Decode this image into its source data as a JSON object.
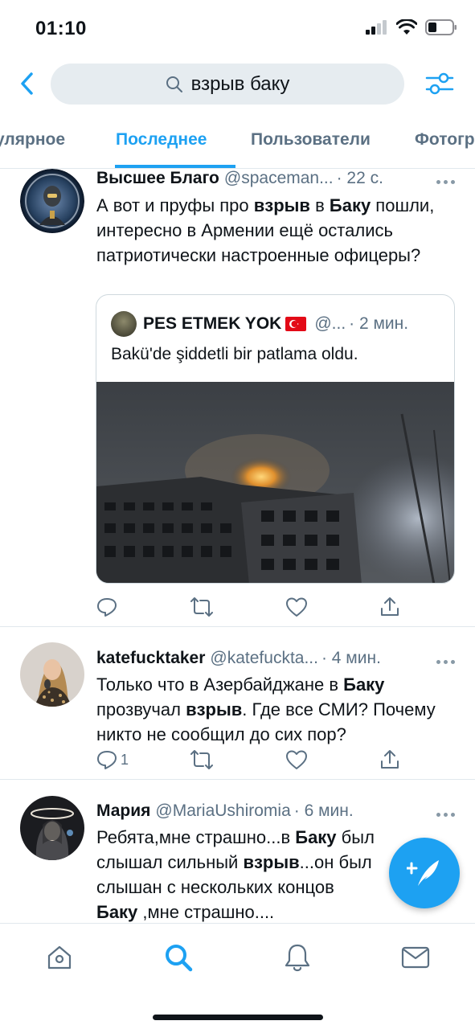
{
  "status_bar": {
    "time": "01:10"
  },
  "search": {
    "query": "взрыв баку"
  },
  "tabs": [
    {
      "label": "улярное",
      "active": false
    },
    {
      "label": "Последнее",
      "active": true
    },
    {
      "label": "Пользователи",
      "active": false
    },
    {
      "label": "Фотогр",
      "active": false
    }
  ],
  "tweets": [
    {
      "name": "Высшее Благо",
      "handle": "@spaceman...",
      "time": "· 22 с.",
      "text_parts": [
        "А вот и пруфы про ",
        "взрыв",
        " в ",
        "Баку",
        " пошли, интересно в Армении ещё остались патриотически настроенные офицеры?"
      ],
      "quote": {
        "name": "PES ETMEK YOK",
        "handle": "@...",
        "time": "· 2 мин.",
        "text": "Bakü'de şiddetli bir patlama oldu."
      },
      "reply_count": "",
      "icons": [
        "reply-icon",
        "retweet-icon",
        "like-icon",
        "share-icon"
      ]
    },
    {
      "name": "katefucktaker",
      "handle": "@katefuckta...",
      "time": "· 4 мин.",
      "text_parts": [
        "Только что в Азербайджане в ",
        "Баку",
        " прозвучал ",
        "взрыв",
        ". Где все СМИ? Почему никто не сообщил до сих пор?"
      ],
      "reply_count": "1"
    },
    {
      "name": "Мария",
      "handle": "@MariaUshiromia",
      "time": "· 6 мин.",
      "text_parts": [
        "Ребята,мне страшно...в ",
        "Баку",
        " был слышал сильный ",
        "взрыв",
        "...он был слышан с нескольких концов ",
        "Баку",
        " ,мне страшно...."
      ]
    }
  ],
  "nav": [
    "home-icon",
    "search-icon",
    "notifications-icon",
    "messages-icon"
  ],
  "colors": {
    "accent": "#1da1f2",
    "secondary_text": "#5b7083",
    "separator": "#e1e8ed"
  }
}
